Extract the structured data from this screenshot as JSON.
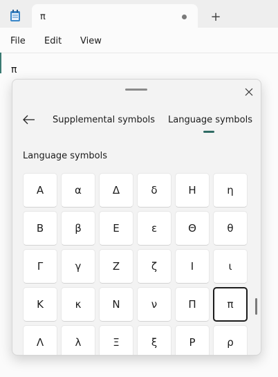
{
  "tab": {
    "title": "π"
  },
  "menu": [
    "File",
    "Edit",
    "View"
  ],
  "editor": {
    "text": "π"
  },
  "panel": {
    "tabs": [
      "Supplemental symbols",
      "Language symbols"
    ],
    "active_tab": "Language symbols",
    "section_title": "Language symbols",
    "symbols": [
      [
        "Α",
        "α",
        "Δ",
        "δ",
        "Η",
        "η"
      ],
      [
        "Β",
        "β",
        "Ε",
        "ε",
        "Θ",
        "θ"
      ],
      [
        "Γ",
        "γ",
        "Ζ",
        "ζ",
        "Ι",
        "ι"
      ],
      [
        "Κ",
        "κ",
        "Ν",
        "ν",
        "Π",
        "π"
      ],
      [
        "Λ",
        "λ",
        "Ξ",
        "ξ",
        "Ρ",
        "ρ"
      ]
    ],
    "selected_symbol": "π"
  },
  "icons": {
    "app": "notepad-icon",
    "new_tab": "plus-icon",
    "modified": "unsaved-dot-icon",
    "close": "close-icon",
    "back": "back-arrow-icon"
  },
  "colors": {
    "accent": "#2f6b64"
  }
}
